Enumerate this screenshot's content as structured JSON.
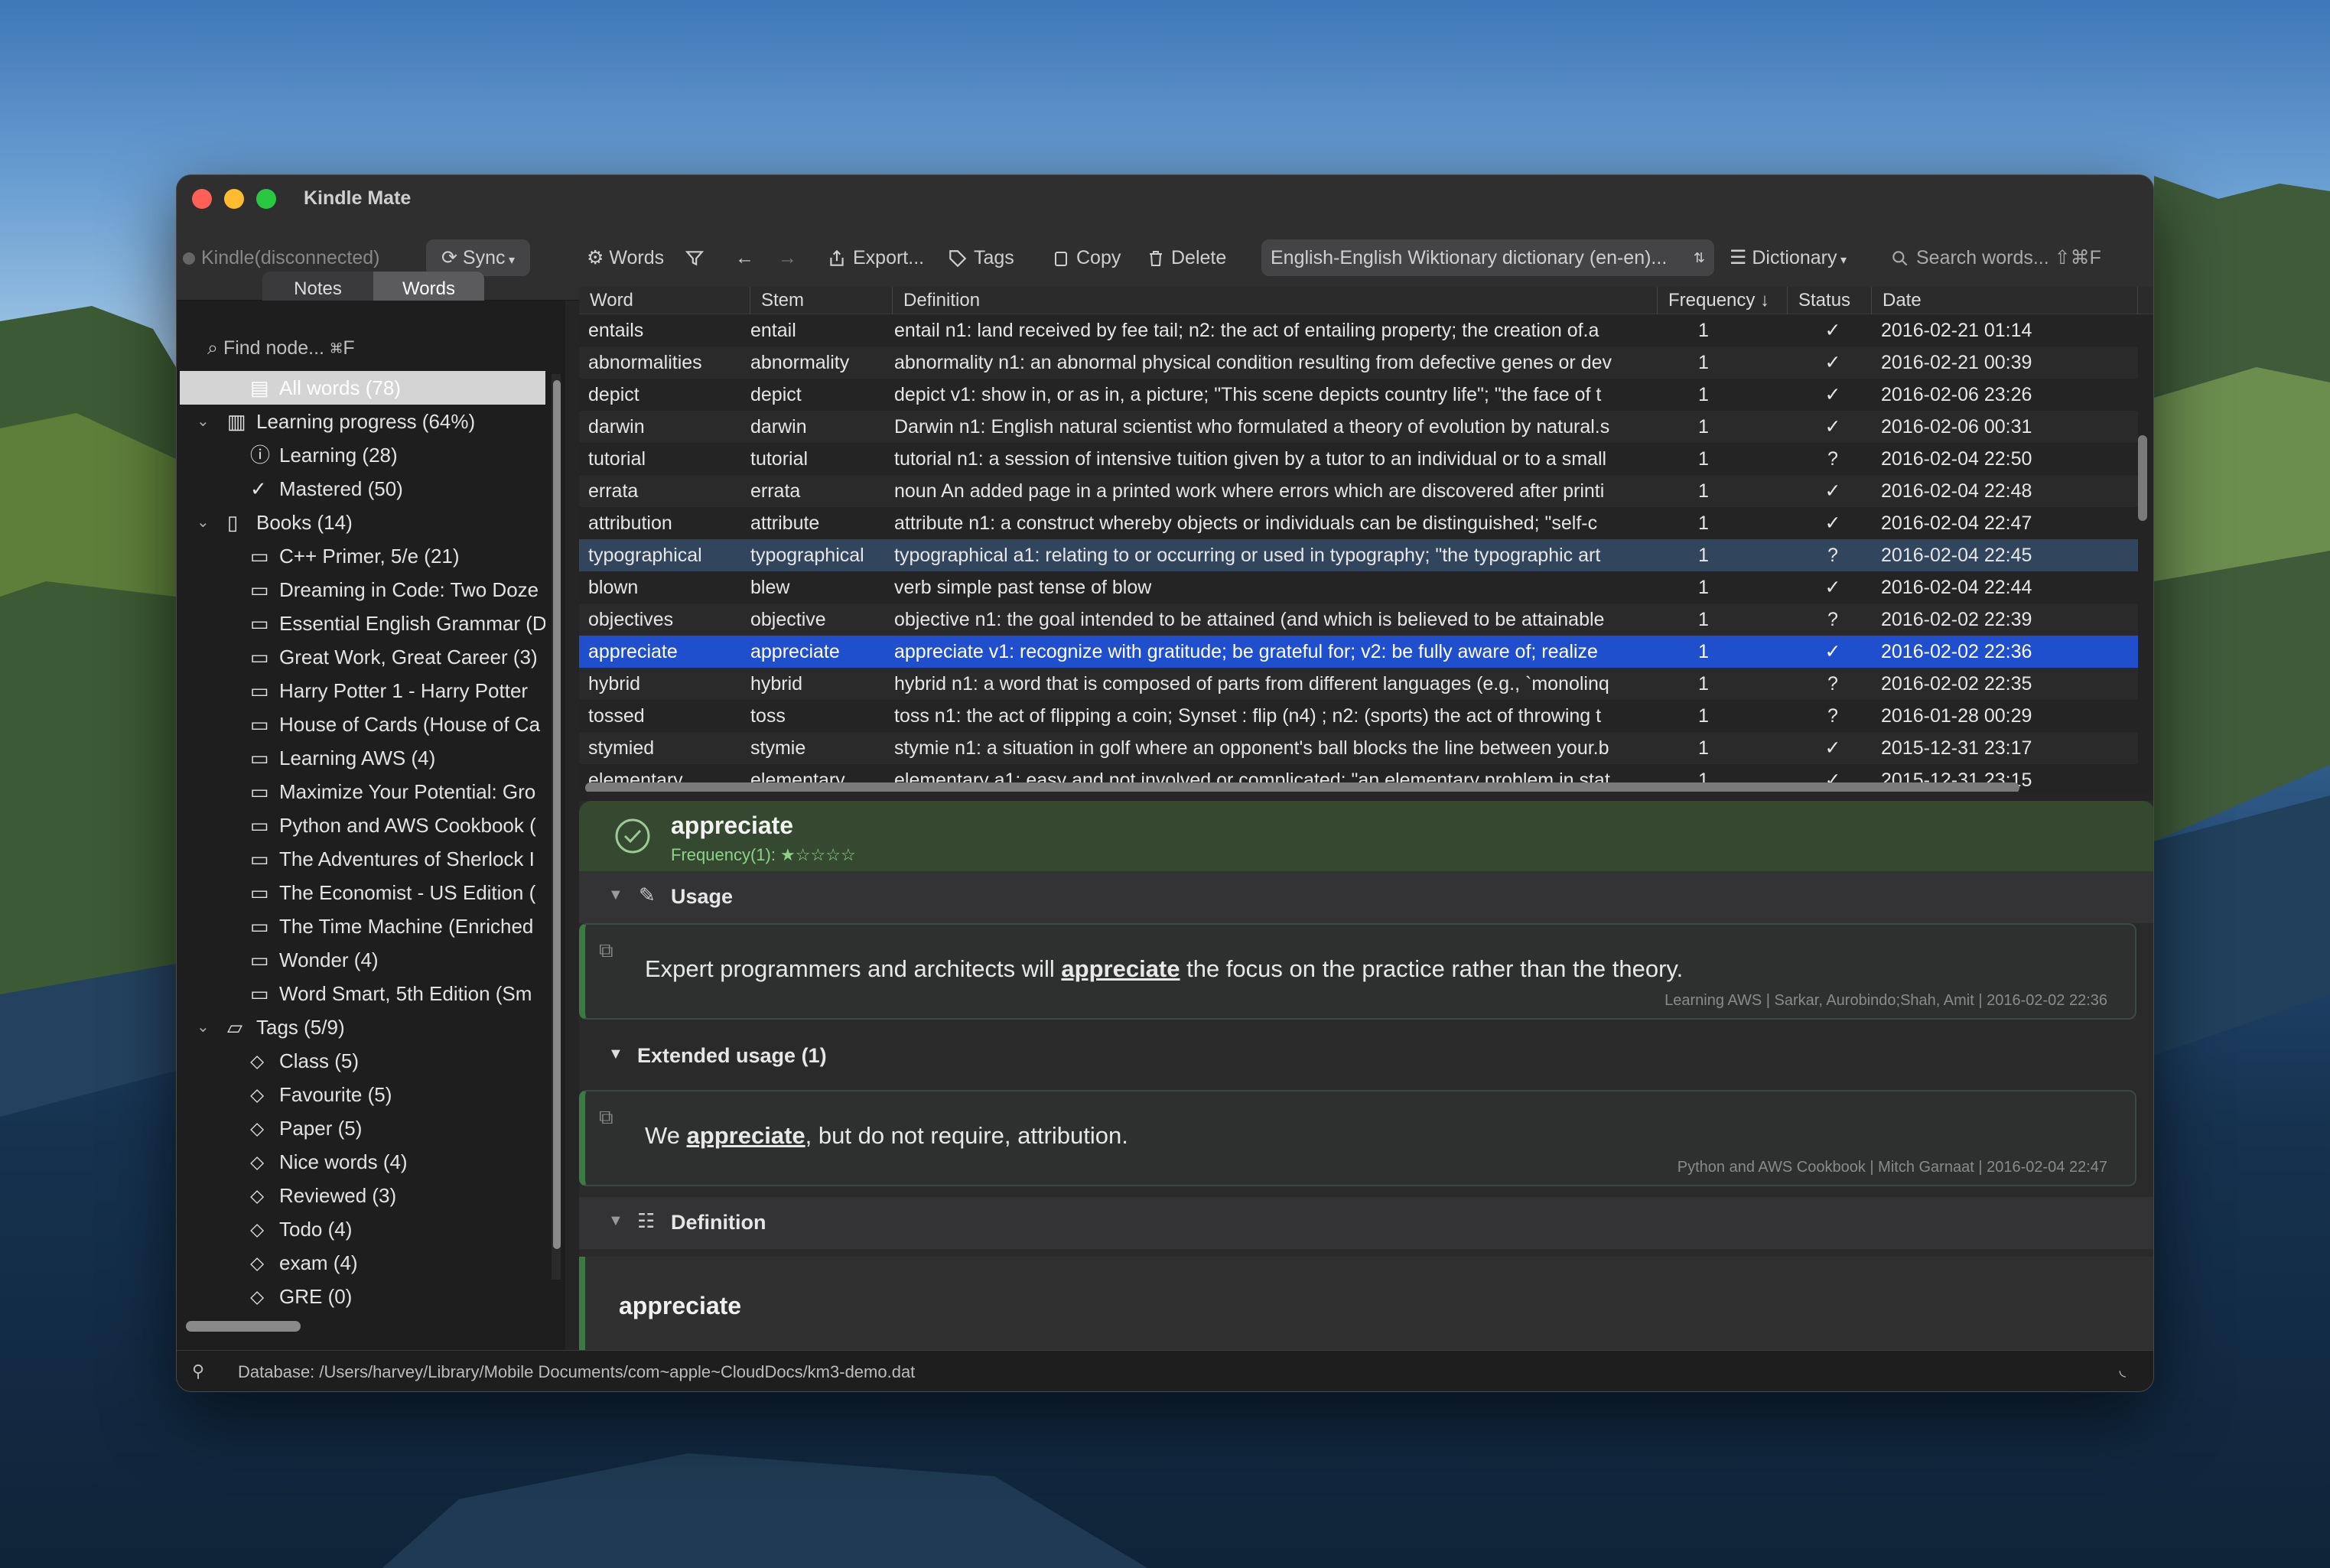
{
  "app": {
    "title": "Kindle Mate"
  },
  "toolbar": {
    "device": "Kindle(disconnected)",
    "sync": "Sync",
    "words": "Words",
    "export": "Export...",
    "tags": "Tags",
    "copy": "Copy",
    "delete": "Delete",
    "dictionary_select": "English-English Wiktionary dictionary (en-en)...",
    "dictionary": "Dictionary",
    "search_placeholder": "Search words... ⇧⌘F"
  },
  "sidebar": {
    "tabs": [
      "Notes",
      "Words"
    ],
    "find_placeholder": "Find node... ⌘F",
    "tree": [
      {
        "label": "All words (78)",
        "level": 1,
        "icon": "stack",
        "selected": true
      },
      {
        "label": "Learning progress (64%)",
        "level": 0,
        "icon": "chart",
        "expanded": true
      },
      {
        "label": "Learning (28)",
        "level": 1,
        "icon": "question"
      },
      {
        "label": "Mastered (50)",
        "level": 1,
        "icon": "check"
      },
      {
        "label": "Books (14)",
        "level": 0,
        "icon": "book",
        "expanded": true
      },
      {
        "label": "C++ Primer, 5/e (21)",
        "level": 1,
        "icon": "doc"
      },
      {
        "label": "Dreaming in Code: Two Doze",
        "level": 1,
        "icon": "doc"
      },
      {
        "label": "Essential English Grammar (D",
        "level": 1,
        "icon": "doc"
      },
      {
        "label": "Great Work, Great Career (3)",
        "level": 1,
        "icon": "doc"
      },
      {
        "label": "Harry Potter 1 - Harry Potter",
        "level": 1,
        "icon": "doc"
      },
      {
        "label": "House of Cards (House of Ca",
        "level": 1,
        "icon": "doc"
      },
      {
        "label": "Learning AWS (4)",
        "level": 1,
        "icon": "doc"
      },
      {
        "label": "Maximize Your Potential: Gro",
        "level": 1,
        "icon": "doc"
      },
      {
        "label": "Python and AWS Cookbook (",
        "level": 1,
        "icon": "doc"
      },
      {
        "label": "The Adventures of Sherlock I",
        "level": 1,
        "icon": "doc"
      },
      {
        "label": "The Economist - US Edition (",
        "level": 1,
        "icon": "doc"
      },
      {
        "label": "The Time Machine (Enriched",
        "level": 1,
        "icon": "doc"
      },
      {
        "label": "Wonder (4)",
        "level": 1,
        "icon": "doc"
      },
      {
        "label": "Word Smart, 5th Edition (Sm",
        "level": 1,
        "icon": "doc"
      },
      {
        "label": "Tags (5/9)",
        "level": 0,
        "icon": "folder",
        "expanded": true
      },
      {
        "label": "Class (5)",
        "level": 1,
        "icon": "tag"
      },
      {
        "label": "Favourite (5)",
        "level": 1,
        "icon": "tag"
      },
      {
        "label": "Paper (5)",
        "level": 1,
        "icon": "tag"
      },
      {
        "label": "Nice words (4)",
        "level": 1,
        "icon": "tag"
      },
      {
        "label": "Reviewed (3)",
        "level": 1,
        "icon": "tag"
      },
      {
        "label": "Todo (4)",
        "level": 1,
        "icon": "tag"
      },
      {
        "label": "exam (4)",
        "level": 1,
        "icon": "tag"
      },
      {
        "label": "GRE (0)",
        "level": 1,
        "icon": "tag"
      }
    ]
  },
  "table": {
    "columns": [
      "Word",
      "Stem",
      "Definition",
      "Frequency ↓",
      "Status",
      "Date"
    ],
    "rows": [
      {
        "word": "entails",
        "stem": "entail",
        "def": "entail n1: land received by fee tail; n2: the act of entailing property; the creation of.a",
        "freq": "1",
        "status": "✓",
        "date": "2016-02-21 01:14"
      },
      {
        "word": "abnormalities",
        "stem": "abnormality",
        "def": "abnormality n1: an abnormal physical condition resulting from defective genes or dev",
        "freq": "1",
        "status": "✓",
        "date": "2016-02-21 00:39"
      },
      {
        "word": "depict",
        "stem": "depict",
        "def": "depict v1: show in, or as in, a picture; \"This scene depicts country life\"; \"the face of t",
        "freq": "1",
        "status": "✓",
        "date": "2016-02-06 23:26"
      },
      {
        "word": "darwin",
        "stem": "darwin",
        "def": "Darwin n1: English natural scientist who formulated a theory of evolution by natural.s",
        "freq": "1",
        "status": "✓",
        "date": "2016-02-06 00:31"
      },
      {
        "word": "tutorial",
        "stem": "tutorial",
        "def": "tutorial n1: a session of intensive tuition given by a tutor to an individual or to a small",
        "freq": "1",
        "status": "?",
        "date": "2016-02-04 22:50"
      },
      {
        "word": "errata",
        "stem": "errata",
        "def": "noun An added page in a printed work where errors which are discovered after printi",
        "freq": "1",
        "status": "✓",
        "date": "2016-02-04 22:48"
      },
      {
        "word": "attribution",
        "stem": "attribute",
        "def": "attribute n1: a construct whereby objects or individuals can be distinguished; \"self-c",
        "freq": "1",
        "status": "✓",
        "date": "2016-02-04 22:47"
      },
      {
        "word": "typographical",
        "stem": "typographical",
        "def": "typographical a1: relating to or occurring or used in typography; \"the typographic art",
        "freq": "1",
        "status": "?",
        "date": "2016-02-04 22:45"
      },
      {
        "word": "blown",
        "stem": "blew",
        "def": "verb simple past tense of blow",
        "freq": "1",
        "status": "✓",
        "date": "2016-02-04 22:44"
      },
      {
        "word": "objectives",
        "stem": "objective",
        "def": "objective n1: the goal intended to be attained (and which is believed to be attainable",
        "freq": "1",
        "status": "?",
        "date": "2016-02-02 22:39"
      },
      {
        "word": "appreciate",
        "stem": "appreciate",
        "def": "appreciate v1: recognize with gratitude; be grateful for; v2: be fully aware of; realize",
        "freq": "1",
        "status": "✓",
        "date": "2016-02-02 22:36"
      },
      {
        "word": "hybrid",
        "stem": "hybrid",
        "def": "hybrid n1: a word that is composed of parts from different languages (e.g., `monolinq",
        "freq": "1",
        "status": "?",
        "date": "2016-02-02 22:35"
      },
      {
        "word": "tossed",
        "stem": "toss",
        "def": "toss n1: the act of flipping a coin; Synset : flip (n4) ; n2: (sports) the act of throwing t",
        "freq": "1",
        "status": "?",
        "date": "2016-01-28 00:29"
      },
      {
        "word": "stymied",
        "stem": "stymie",
        "def": "stymie n1: a situation in golf where an opponent's ball blocks the line between your.b",
        "freq": "1",
        "status": "✓",
        "date": "2015-12-31 23:17"
      },
      {
        "word": "elementary",
        "stem": "elementary",
        "def": "elementary a1: easy and not involved or complicated; \"an elementary problem in stat",
        "freq": "1",
        "status": "✓",
        "date": "2015-12-31 23:15"
      }
    ]
  },
  "detail": {
    "word": "appreciate",
    "frequency": "Frequency(1): ★☆☆☆☆",
    "usage_title": "Usage",
    "usage": {
      "before": "Expert programmers and architects will ",
      "word": "appreciate",
      "after": " the focus on the practice rather than the theory.",
      "source": "Learning AWS | Sarkar, Aurobindo;Shah, Amit | 2016-02-02 22:36"
    },
    "ext_title": "Extended usage (1)",
    "ext": {
      "before": "We ",
      "word": "appreciate",
      "after": ", but do not require, attribution.",
      "source": "Python and AWS Cookbook | Mitch Garnaat | 2016-02-04 22:47"
    },
    "def_title": "Definition",
    "def_word": "appreciate"
  },
  "status": {
    "database": "Database: /Users/harvey/Library/Mobile Documents/com~apple~CloudDocs/km3-demo.dat"
  },
  "colors": {
    "accent_select": "#1f4fcc",
    "header_green": "#34492f",
    "card_border": "#3d7a43"
  }
}
